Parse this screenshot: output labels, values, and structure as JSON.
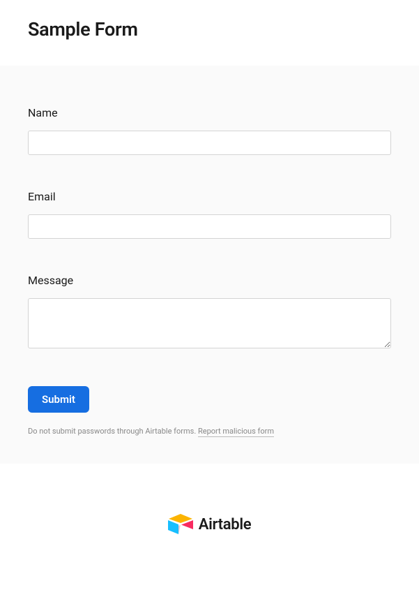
{
  "header": {
    "title": "Sample Form"
  },
  "fields": {
    "name": {
      "label": "Name",
      "value": ""
    },
    "email": {
      "label": "Email",
      "value": ""
    },
    "message": {
      "label": "Message",
      "value": ""
    }
  },
  "submit": {
    "label": "Submit"
  },
  "disclaimer": {
    "text": "Do not submit passwords through Airtable forms. ",
    "link_text": "Report malicious form"
  },
  "footer": {
    "brand": "Airtable"
  }
}
